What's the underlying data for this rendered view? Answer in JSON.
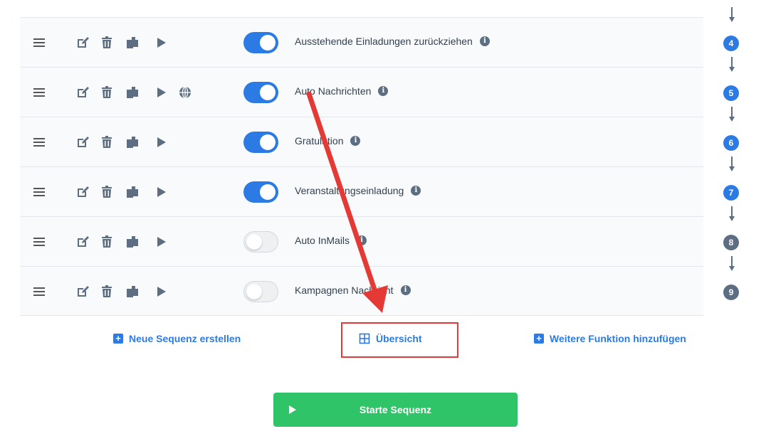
{
  "sequences": [
    {
      "label": "Ausstehende Einladungen zurückziehen",
      "enabled": true,
      "has_globe": false
    },
    {
      "label": "Auto Nachrichten",
      "enabled": true,
      "has_globe": true
    },
    {
      "label": "Gratulation",
      "enabled": true,
      "has_globe": false
    },
    {
      "label": "Veranstaltungseinladung",
      "enabled": true,
      "has_globe": false
    },
    {
      "label": "Auto InMails",
      "enabled": false,
      "has_globe": false
    },
    {
      "label": "Kampagnen Nachricht",
      "enabled": false,
      "has_globe": false
    }
  ],
  "flow_steps": [
    {
      "number": "4",
      "color": "#2c7be5"
    },
    {
      "number": "5",
      "color": "#2c7be5"
    },
    {
      "number": "6",
      "color": "#2c7be5"
    },
    {
      "number": "7",
      "color": "#2c7be5"
    },
    {
      "number": "8",
      "color": "#5e6e82"
    },
    {
      "number": "9",
      "color": "#5e6e82"
    }
  ],
  "info_glyph": "i",
  "links": {
    "new_sequence": "Neue Sequenz erstellen",
    "overview": "Übersicht",
    "add_function": "Weitere Funktion hinzufügen"
  },
  "start_button": "Starte Sequenz",
  "colors": {
    "accent": "#2c7be5",
    "success": "#2fc467",
    "annotation": "#e53935",
    "muted": "#5e6e82"
  }
}
